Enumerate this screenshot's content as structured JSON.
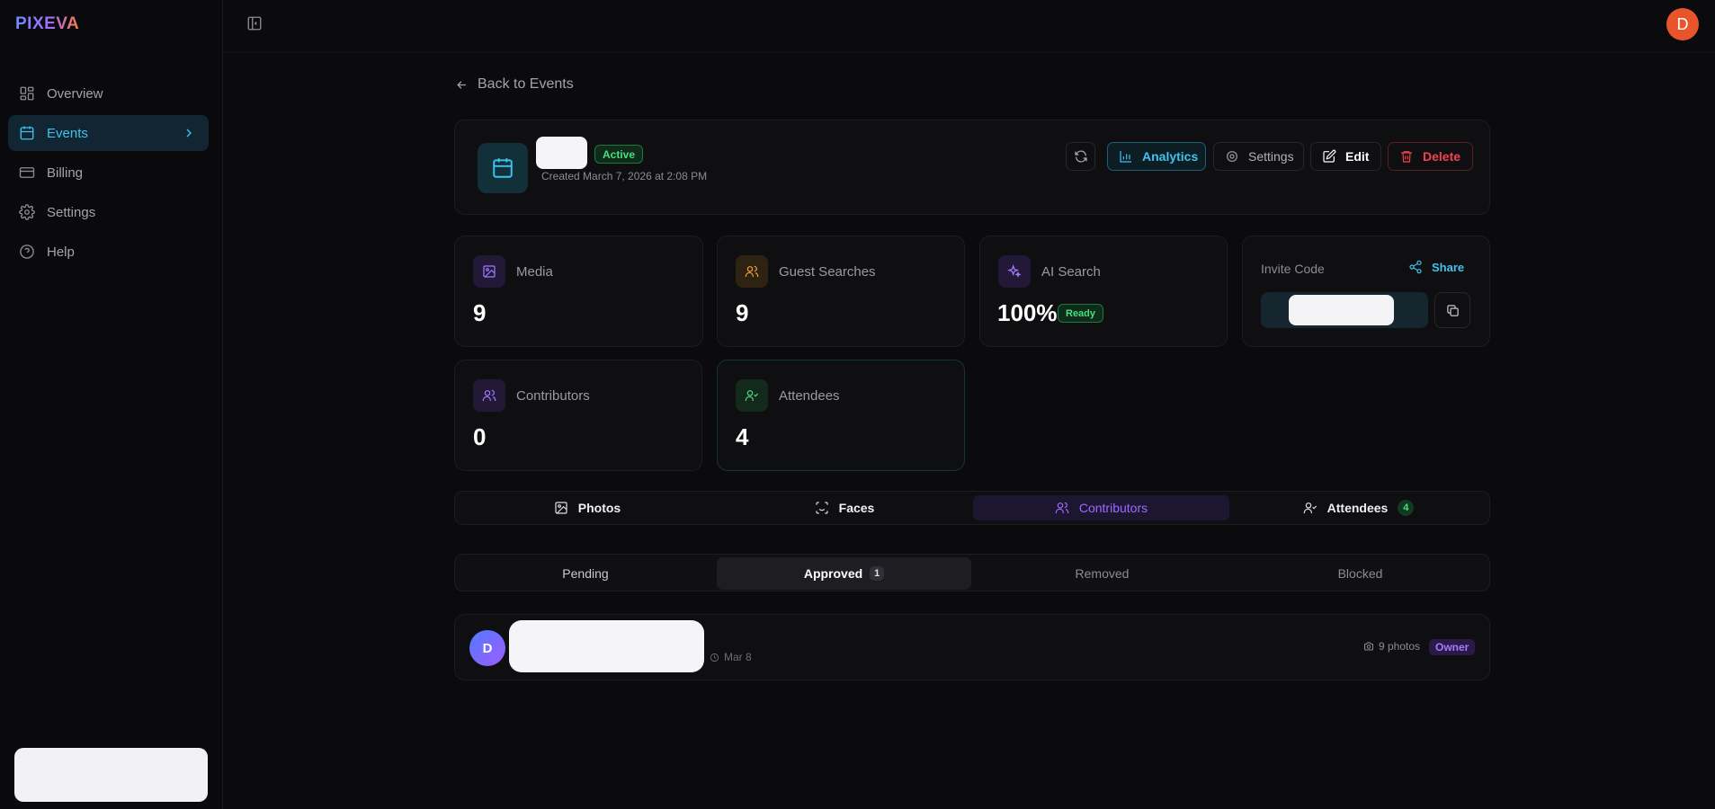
{
  "app": {
    "logo": "PIXEVA"
  },
  "sidebar": {
    "items": [
      {
        "label": "Overview",
        "icon": "grid-icon"
      },
      {
        "label": "Events",
        "icon": "calendar-icon",
        "active": true
      },
      {
        "label": "Billing",
        "icon": "credit-card-icon"
      },
      {
        "label": "Settings",
        "icon": "gear-icon"
      },
      {
        "label": "Help",
        "icon": "help-circle-icon"
      }
    ]
  },
  "header": {
    "avatar_initial": "D"
  },
  "back_link": {
    "label": "Back to Events"
  },
  "event": {
    "status": "Active",
    "created": "Created March 7, 2026 at 2:08 PM",
    "actions": {
      "analytics": "Analytics",
      "settings": "Settings",
      "edit": "Edit",
      "delete": "Delete"
    }
  },
  "stats": {
    "media": {
      "label": "Media",
      "value": "9"
    },
    "guest_searches": {
      "label": "Guest Searches",
      "value": "9"
    },
    "ai_search": {
      "label": "AI Search",
      "value": "100%",
      "badge": "Ready"
    },
    "invite": {
      "label": "Invite Code",
      "share": "Share"
    },
    "contributors": {
      "label": "Contributors",
      "value": "0"
    },
    "attendees": {
      "label": "Attendees",
      "value": "4"
    }
  },
  "tabs": {
    "photos": "Photos",
    "faces": "Faces",
    "contributors": "Contributors",
    "attendees": "Attendees",
    "attendees_count": "4"
  },
  "subtabs": {
    "pending": "Pending",
    "approved": "Approved",
    "approved_count": "1",
    "removed": "Removed",
    "blocked": "Blocked"
  },
  "contributor_row": {
    "initial": "D",
    "date": "Mar 8",
    "photos": "9 photos",
    "role": "Owner"
  },
  "colors": {
    "accent_cyan": "#3fc3ee",
    "accent_purple": "#9d6bff",
    "success_green": "#4ade80",
    "danger_red": "#f0434f",
    "avatar_orange": "#e9552a"
  }
}
